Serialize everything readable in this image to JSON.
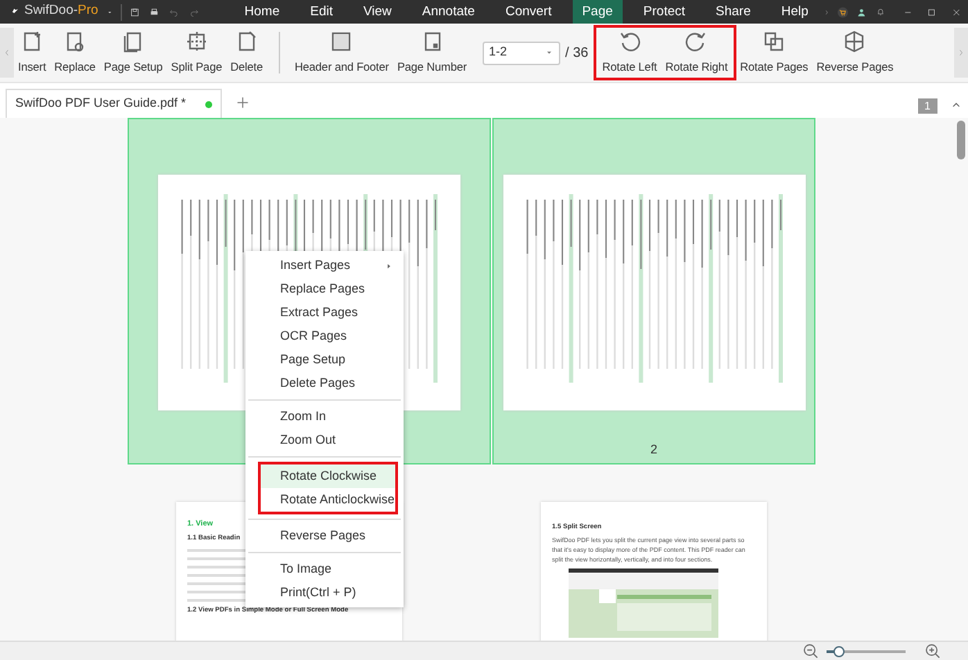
{
  "title_bar": {
    "app_name": "SwifDoo-",
    "edition": "Pro",
    "menus": [
      {
        "label": "Home",
        "selected": false
      },
      {
        "label": "Edit",
        "selected": false
      },
      {
        "label": "View",
        "selected": false
      },
      {
        "label": "Annotate",
        "selected": false
      },
      {
        "label": "Convert",
        "selected": false
      },
      {
        "label": "Page",
        "selected": true
      },
      {
        "label": "Protect",
        "selected": false
      },
      {
        "label": "Share",
        "selected": false
      },
      {
        "label": "Help",
        "selected": false
      }
    ]
  },
  "ribbon": {
    "sections": [
      {
        "kind": "buttons",
        "highlighted": false,
        "buttons": [
          "Insert",
          "Replace",
          "Page Setup",
          "Split Page",
          "Delete"
        ]
      },
      {
        "kind": "divider"
      },
      {
        "kind": "buttons",
        "highlighted": false,
        "buttons": [
          "Header and Footer",
          "Page Number"
        ]
      },
      {
        "kind": "page_range",
        "value": "1-2",
        "total": "/ 36"
      },
      {
        "kind": "buttons",
        "highlighted": true,
        "buttons": [
          "Rotate Left",
          "Rotate Right"
        ]
      },
      {
        "kind": "buttons",
        "highlighted": false,
        "buttons": [
          "Rotate Pages",
          "Reverse Pages"
        ]
      }
    ]
  },
  "document_tabs": [
    {
      "label": "SwifDoo PDF User Guide.pdf *",
      "selected": true
    }
  ],
  "page_badge": "1",
  "thumbnails": [
    {
      "kind": "toc",
      "selected": true
    },
    {
      "kind": "toc",
      "selected": true,
      "label": "2"
    },
    {
      "kind": "text",
      "selected": false,
      "heading": "1. View",
      "subheading": "1.1 Basic Readin",
      "section": "1.2 View PDFs in Simple Mode or Full Screen Mode"
    },
    {
      "kind": "screenshot",
      "selected": false,
      "subheading": "1.5 Split Screen",
      "paragraph": "SwifDoo PDF lets you split the current page view into several parts so that it's easy to display more of the PDF content. This PDF reader can split the view horizontally, vertically, and into four sections."
    }
  ],
  "context_menu": [
    {
      "highlighted": false,
      "items": [
        {
          "label": "Insert Pages",
          "submenu": true,
          "selected": false
        },
        {
          "label": "Replace Pages",
          "selected": false
        },
        {
          "label": "Extract Pages",
          "selected": false
        },
        {
          "label": "OCR Pages",
          "selected": false
        },
        {
          "label": "Page Setup",
          "selected": false
        },
        {
          "label": "Delete Pages",
          "selected": false
        }
      ]
    },
    {
      "highlighted": false,
      "items": [
        {
          "label": "Zoom In",
          "selected": false
        },
        {
          "label": "Zoom Out",
          "selected": false
        }
      ]
    },
    {
      "highlighted": true,
      "items": [
        {
          "label": "Rotate Clockwise",
          "selected": true
        },
        {
          "label": "Rotate Anticlockwise",
          "selected": false
        }
      ]
    },
    {
      "highlighted": false,
      "items": [
        {
          "label": "Reverse Pages",
          "selected": false
        }
      ]
    },
    {
      "highlighted": false,
      "items": [
        {
          "label": "To Image",
          "selected": false
        },
        {
          "label": "Print(Ctrl + P)",
          "selected": false
        }
      ]
    }
  ],
  "zoom": {
    "level": 0.15
  }
}
